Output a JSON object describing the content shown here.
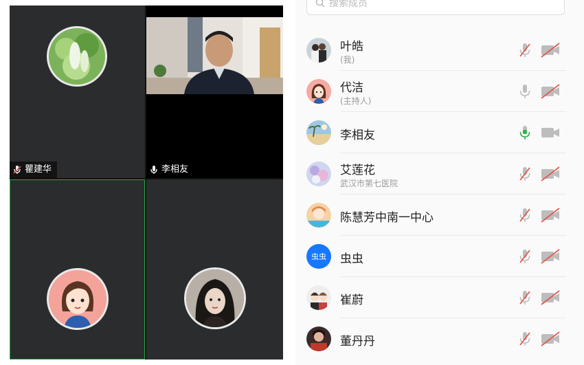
{
  "search": {
    "placeholder": "搜索成员"
  },
  "video_tiles": [
    {
      "name": "瞿建华",
      "muted": true
    },
    {
      "name": "李相友",
      "muted": false
    },
    {
      "name": "",
      "muted": true
    },
    {
      "name": "",
      "muted": true
    }
  ],
  "participants": [
    {
      "name": "叶皓",
      "note": "(我)",
      "avatar": "couple-photo",
      "mic": "muted",
      "camera": "off"
    },
    {
      "name": "代洁",
      "note": "(主持人)",
      "avatar": "cartoon-woman",
      "mic": "on-gray",
      "camera": "off"
    },
    {
      "name": "李相友",
      "note": "",
      "avatar": "beach-photo",
      "mic": "speaking",
      "camera": "on"
    },
    {
      "name": "艾莲花",
      "note": "武汉市第七医院",
      "avatar": "flower-photo",
      "mic": "muted",
      "camera": "off"
    },
    {
      "name": "陈慧芳中南一中心",
      "note": "",
      "avatar": "anime-photo",
      "mic": "muted",
      "camera": "off"
    },
    {
      "name": "虫虫",
      "note": "",
      "avatar": "text-avatar",
      "avatar_text": "虫虫",
      "mic": "muted",
      "camera": "off"
    },
    {
      "name": "崔蔚",
      "note": "",
      "avatar": "cartoon-couple",
      "mic": "muted",
      "camera": "off"
    },
    {
      "name": "董丹丹",
      "note": "",
      "avatar": "portrait-photo",
      "mic": "muted",
      "camera": "off"
    }
  ],
  "colors": {
    "muted_red": "#e05a50",
    "speaking_green": "#2db34a",
    "icon_gray": "#9a9a9a",
    "accent_blue": "#1677ff"
  }
}
